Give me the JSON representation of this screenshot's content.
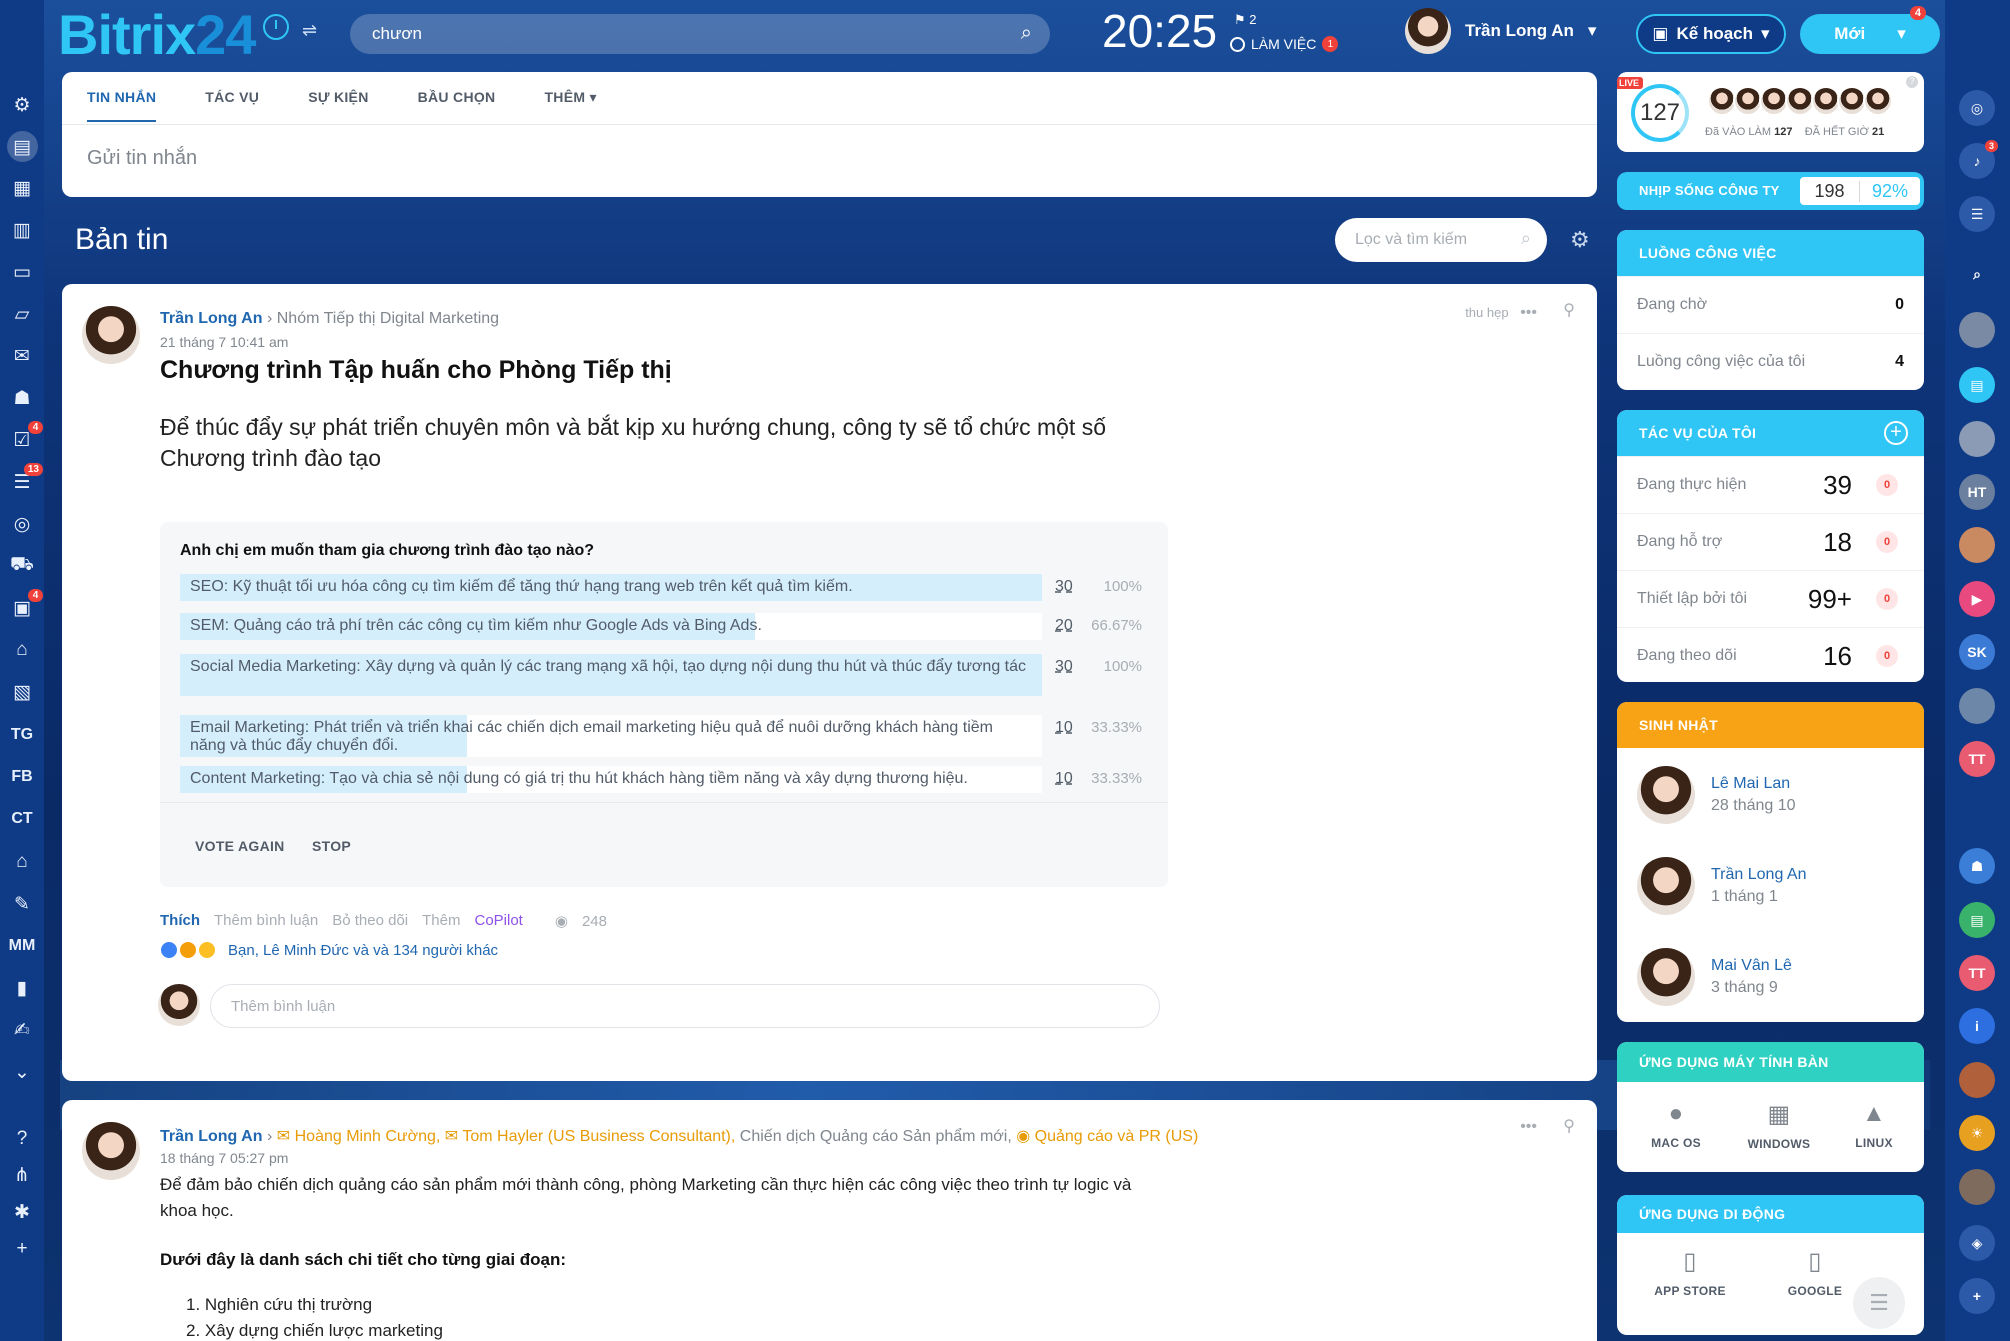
{
  "header": {
    "logo_main": "Bitrix",
    "logo_num": "24",
    "filter_glyph": "⇌",
    "search_value": "chươn",
    "time": "20:25",
    "flag_count": "2",
    "work_status": "LÀM VIỆC",
    "work_badge": "1",
    "user_name": "Trần Long An",
    "plan_label": "Kế hoạch",
    "new_label": "Mới",
    "new_badge": "4",
    "help_badge": "1"
  },
  "leftnav": {
    "items": [
      {
        "name": "sites-icon",
        "glyph": "⚙"
      },
      {
        "name": "feed-icon",
        "glyph": "▤"
      },
      {
        "name": "calendar-icon",
        "glyph": "▦"
      },
      {
        "name": "docs-icon",
        "glyph": "▥"
      },
      {
        "name": "drive-icon",
        "glyph": "▭"
      },
      {
        "name": "chat-icon",
        "glyph": "▱"
      },
      {
        "name": "mail-icon",
        "glyph": "✉"
      },
      {
        "name": "groups-icon",
        "glyph": "☗"
      },
      {
        "name": "tasks-icon",
        "glyph": "☑",
        "badge": "4"
      },
      {
        "name": "filter-icon",
        "glyph": "☰",
        "badge": "13"
      },
      {
        "name": "target-icon",
        "glyph": "◎"
      },
      {
        "name": "cart-icon",
        "glyph": "⛟"
      },
      {
        "name": "contacts-icon",
        "glyph": "▣",
        "badge": "4"
      },
      {
        "name": "robot-icon",
        "glyph": "⌂"
      },
      {
        "name": "box-icon",
        "glyph": "▧"
      },
      {
        "name": "TG",
        "text": "TG"
      },
      {
        "name": "FB",
        "text": "FB"
      },
      {
        "name": "CT",
        "text": "CT"
      },
      {
        "name": "bank-icon",
        "glyph": "⌂"
      },
      {
        "name": "sign-icon",
        "glyph": "✎"
      },
      {
        "name": "MM",
        "text": "MM"
      },
      {
        "name": "analytics-icon",
        "glyph": "▮"
      },
      {
        "name": "edit-list-icon",
        "glyph": "✍"
      },
      {
        "name": "more-icon",
        "glyph": "⌄"
      },
      {
        "name": "help-icon",
        "glyph": "?"
      },
      {
        "name": "sitemap-icon",
        "glyph": "⋔"
      },
      {
        "name": "settings-icon",
        "glyph": "✱"
      },
      {
        "name": "add-icon",
        "glyph": "+"
      }
    ]
  },
  "composer": {
    "tabs": [
      "TIN NHẮN",
      "TÁC VỤ",
      "SỰ KIỆN",
      "BẦU CHỌN",
      "THÊM ▾"
    ],
    "placeholder": "Gửi tin nhắn"
  },
  "feed": {
    "title": "Bản tin",
    "search_placeholder": "Lọc và tìm kiếm"
  },
  "post1": {
    "author": "Trần Long An",
    "dest": "Nhóm Tiếp thị Digital Marketing",
    "date": "21 tháng 7 10:41 am",
    "title": "Chương trình Tập huấn cho Phòng Tiếp thị",
    "text": "Để thúc đẩy sự phát triển chuyên môn và bắt kịp xu hướng chung, công ty sẽ tổ chức một số Chương trình đào tạo",
    "collapse_label": "thu hẹp",
    "poll": {
      "question": "Anh chị em muốn tham gia chương trình đào tạo nào?",
      "options": [
        {
          "label": "SEO: Kỹ thuật tối ưu hóa công cụ tìm kiếm để tăng thứ hạng trang web trên kết quả tìm kiếm.",
          "count": "30",
          "pct": "100%",
          "fraction": 1.0
        },
        {
          "label": "SEM: Quảng cáo trả phí trên các công cụ tìm kiếm như Google Ads và Bing Ads.",
          "count": "20",
          "pct": "66.67%",
          "fraction": 0.6667
        },
        {
          "label": "Social Media Marketing: Xây dựng và quản lý các trang mạng xã hội, tạo dựng nội dung thu hút và thúc đẩy tương tác",
          "count": "30",
          "pct": "100%",
          "fraction": 1.0
        },
        {
          "label": "Email Marketing: Phát triển và triển khai các chiến dịch email marketing hiệu quả để nuôi dưỡng khách hàng tiềm năng và thúc đẩy chuyển đổi.",
          "count": "10",
          "pct": "33.33%",
          "fraction": 0.3333
        },
        {
          "label": "Content Marketing: Tạo và chia sẻ nội dung có giá trị thu hút khách hàng tiềm năng và xây dựng thương hiệu.",
          "count": "10",
          "pct": "33.33%",
          "fraction": 0.3333
        }
      ],
      "vote_again": "VOTE AGAIN",
      "stop": "STOP"
    },
    "actions": {
      "like": "Thích",
      "comment": "Thêm bình luận",
      "unfollow": "Bỏ theo dõi",
      "more": "Thêm",
      "copilot": "CoPilot",
      "views": "248"
    },
    "reactions_text": "Bạn, Lê Minh Đức và và 134 người khác",
    "comment_placeholder": "Thêm bình luận"
  },
  "post2": {
    "author": "Trần Long An",
    "recipients_prefix": "›",
    "r1": "Hoàng Minh Cường,",
    "r2": "Tom Hayler (US Business Consultant),",
    "r3": "Chiến dịch Quảng cáo Sản phẩm mới,",
    "r4": "Quảng cáo và PR (US)",
    "date": "18 tháng 7 05:27 pm",
    "text": "Để đảm bảo chiến dịch quảng cáo sản phẩm mới thành công, phòng Marketing cần thực hiện các công việc theo trình tự logic và khoa học.",
    "subtitle": "Dưới đây là danh sách chi tiết cho từng giai đoạn:",
    "list": [
      "1. Nghiên cứu thị trường",
      "2. Xây dựng chiến lược marketing"
    ]
  },
  "live": {
    "tag": "LIVE",
    "count": "127",
    "started_label": "Đã VÀO LÀM",
    "started_value": "127",
    "ended_label": "ĐÃ HẾT GIỜ",
    "ended_value": "21"
  },
  "pulse": {
    "label": "NHỊP SỐNG CÔNG TY",
    "value": "198",
    "pct": "92%"
  },
  "workflows": {
    "title": "LUỒNG CÔNG VIỆC",
    "rows": [
      {
        "label": "Đang chờ",
        "value": "0"
      },
      {
        "label": "Luồng công việc của tôi",
        "value": "4"
      }
    ]
  },
  "mytasks": {
    "title": "TÁC VỤ CỦA TÔI",
    "rows": [
      {
        "label": "Đang thực hiện",
        "value": "39",
        "zero": "0"
      },
      {
        "label": "Đang hỗ trợ",
        "value": "18",
        "zero": "0"
      },
      {
        "label": "Thiết lập bởi tôi",
        "value": "99+",
        "zero": "0"
      },
      {
        "label": "Đang theo dõi",
        "value": "16",
        "zero": "0"
      }
    ]
  },
  "birthdays": {
    "title": "SINH NHẬT",
    "people": [
      {
        "name": "Lê Mai Lan",
        "date": "28 tháng 10"
      },
      {
        "name": "Trần Long An",
        "date": "1 tháng 1"
      },
      {
        "name": "Mai Vân Lê",
        "date": "3 tháng 9"
      }
    ]
  },
  "desktop_apps": {
    "title": "ỨNG DỤNG MÁY TÍNH BÀN",
    "apps": [
      "MAC OS",
      "WINDOWS",
      "LINUX"
    ]
  },
  "mobile_apps": {
    "title": "ỨNG DỤNG DI ĐỘNG",
    "apps": [
      "APP STORE",
      "GOOGLE"
    ]
  },
  "rightnav": {
    "items": [
      {
        "name": "copilot-icon",
        "text": "◎"
      },
      {
        "name": "bell-icon",
        "text": "♪",
        "badge": "3"
      },
      {
        "name": "messages-icon",
        "text": "☰"
      },
      {
        "name": "search-icon",
        "text": "⌕"
      },
      {
        "name": "user-avatar",
        "text": ""
      },
      {
        "name": "chat-icon",
        "text": "▤"
      },
      {
        "name": "user-avatar",
        "text": ""
      },
      {
        "name": "HT",
        "text": "HT"
      },
      {
        "name": "group-avatar",
        "text": ""
      },
      {
        "name": "video-icon",
        "text": "▶"
      },
      {
        "name": "SK",
        "text": "SK"
      },
      {
        "name": "user-avatar",
        "text": ""
      },
      {
        "name": "TT",
        "text": "TT"
      },
      {
        "name": "group-icon",
        "text": "☗"
      },
      {
        "name": "notes-icon",
        "text": "▤"
      },
      {
        "name": "TT",
        "text": "TT"
      },
      {
        "name": "info-icon",
        "text": "i"
      },
      {
        "name": "group-avatar",
        "text": ""
      },
      {
        "name": "idea-icon",
        "text": "☀"
      },
      {
        "name": "user-avatar",
        "text": ""
      },
      {
        "name": "security-icon",
        "text": "◈"
      },
      {
        "name": "add-user-icon",
        "text": "+"
      }
    ]
  },
  "colors": {
    "accent": "#2fc6f6",
    "link": "#2067b0",
    "birthday": "#f8a316",
    "badge": "#f0413a"
  }
}
